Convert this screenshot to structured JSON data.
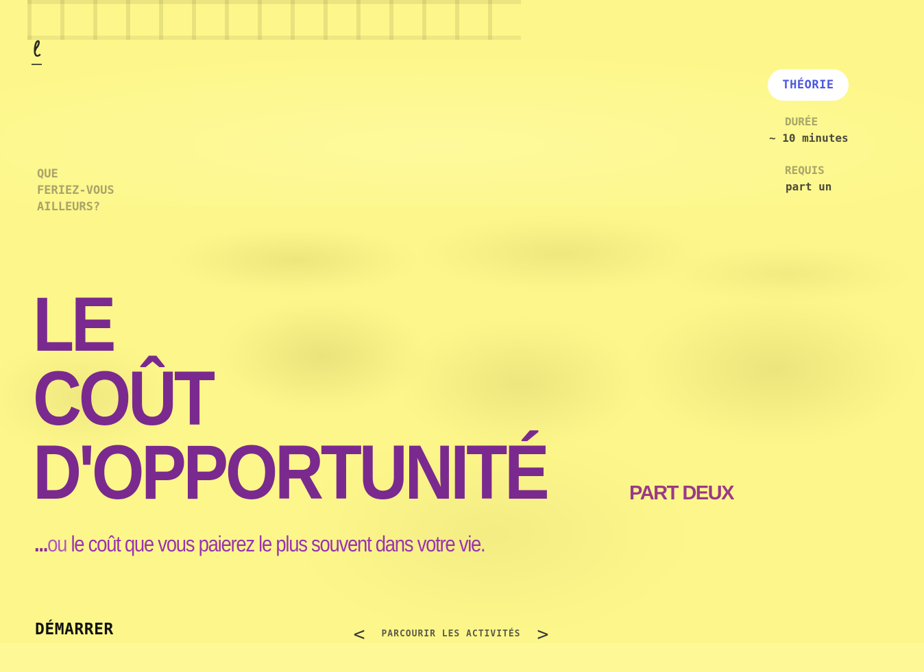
{
  "brand": {
    "logo_icon": "script-l-logo-icon"
  },
  "header": {
    "category_pill": "THÉORIE",
    "duration_label": "DURÉE",
    "duration_value": "~ 10 minutes",
    "requires_label": "REQUIS",
    "requires_value": "part un"
  },
  "hero": {
    "kicker_lines": [
      "QUE",
      "FERIEZ-VOUS",
      "AILLEURS?"
    ],
    "title_lines": [
      "LE",
      "COÛT",
      "D'OPPORTUNITÉ"
    ],
    "part_label": "PART DEUX",
    "subtitle_dots": "...",
    "subtitle_ou": "ou ",
    "subtitle_rest": "le coût que vous paierez le plus souvent dans votre vie."
  },
  "footer": {
    "start_label": "DÉMARRER",
    "prev_arrow": "<",
    "browse_label": "PARCOURIR LES ACTIVITÉS",
    "next_arrow": ">"
  },
  "colors": {
    "background": "#fdf78b",
    "title": "#7a2a8e",
    "accent_blue": "#4b57e0",
    "pill_bg": "#ffffff"
  }
}
